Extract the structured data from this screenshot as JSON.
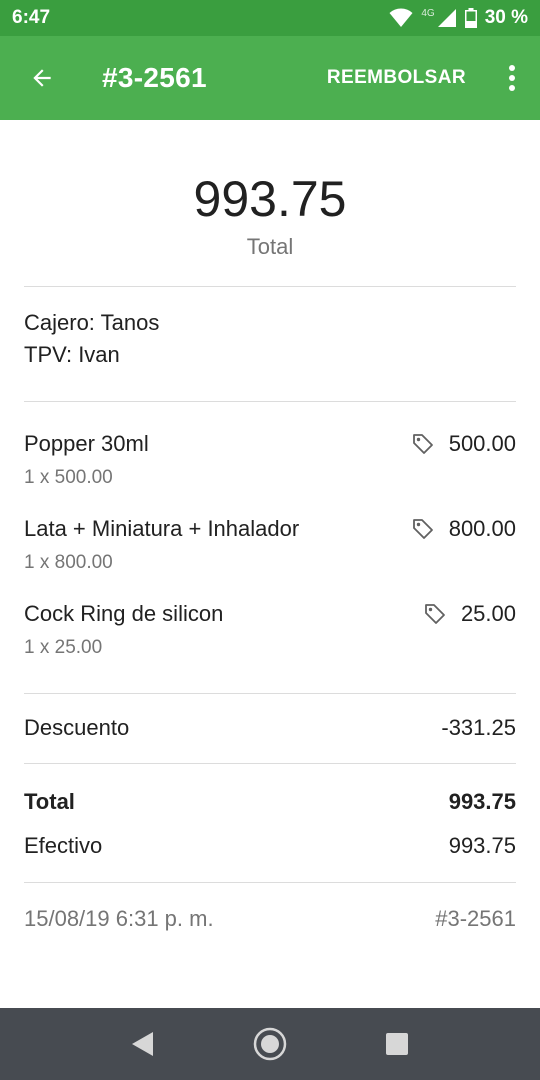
{
  "status_bar": {
    "time": "6:47",
    "network": "4G",
    "battery": "30 %",
    "icons": [
      "wifi-icon",
      "cell-signal-icon",
      "battery-icon"
    ]
  },
  "app_bar": {
    "title": "#3-2561",
    "refund_label": "REEMBOLSAR",
    "icons": [
      "back-arrow-icon",
      "more-vert-icon"
    ],
    "color": "#4caf50"
  },
  "receipt": {
    "total_amount": "993.75",
    "total_caption": "Total",
    "cashier": "Cajero: Tanos",
    "pos": "TPV: Ivan",
    "items": [
      {
        "name": "Popper 30ml",
        "qty_line": "1 x 500.00",
        "price": "500.00"
      },
      {
        "name": "Lata + Miniatura + Inhalador",
        "qty_line": "1 x 800.00",
        "price": "800.00"
      },
      {
        "name": "Cock Ring de silicon",
        "qty_line": "1 x 25.00",
        "price": "25.00"
      }
    ],
    "discount_label": "Descuento",
    "discount_value": "-331.25",
    "total_label": "Total",
    "total_value": "993.75",
    "payment_label": "Efectivo",
    "payment_value": "993.75",
    "datetime": "15/08/19 6:31 p. m.",
    "receipt_number": "#3-2561"
  },
  "nav_bar": {
    "icons": [
      "nav-back-icon",
      "nav-home-icon",
      "nav-recents-icon"
    ]
  }
}
